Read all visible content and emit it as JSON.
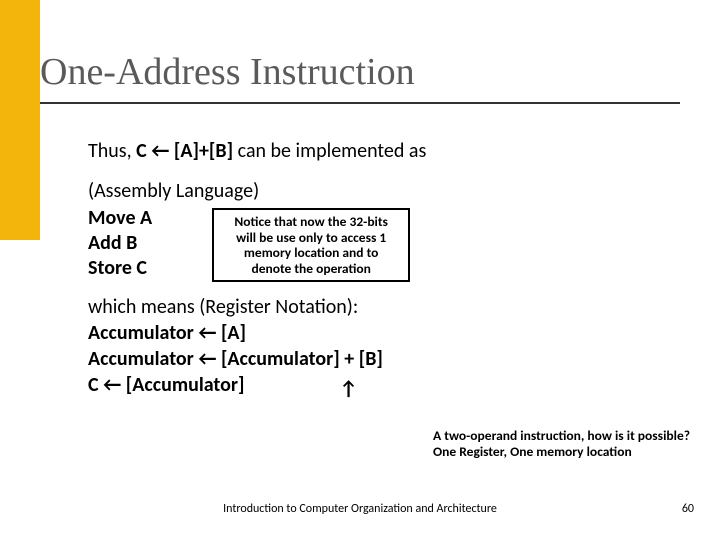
{
  "title": "One-Address Instruction",
  "line1_pre": "Thus, ",
  "line1_bold": "C ← [A]+[B]",
  "line1_post": "  can be implemented as",
  "asm_heading": "(Assembly Language)",
  "asm": {
    "l1": "Move A",
    "l2": "Add B",
    "l3": "Store C"
  },
  "notice": {
    "l1": "Notice that now the 32-bits",
    "l2": "will be use only to access 1",
    "l3": "memory location and to",
    "l4": "denote the operation"
  },
  "reg_heading": "which means (Register Notation):",
  "reg": {
    "l1": "Accumulator ← [A]",
    "l2": "Accumulator ← [Accumulator] + [B]",
    "l3_pre": "C ← [Accumulator]",
    "arrow": "↑"
  },
  "note2": {
    "l1": "A two-operand instruction, how is it possible?",
    "l2": "One Register, One memory location"
  },
  "footer": "Introduction to Computer Organization and Architecture",
  "pagenum": "60"
}
